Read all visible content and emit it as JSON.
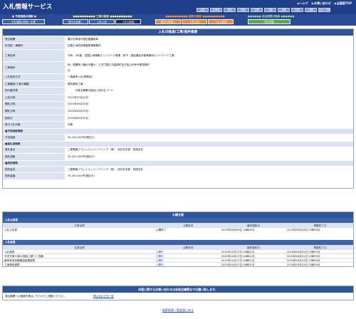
{
  "header": {
    "app_title": "入札情報サービス",
    "top_links": [
      "▶ヘルプ",
      "▶お問い合わせ",
      "▶全国版TOP"
    ],
    "regions": [
      "全国",
      "北海道",
      "東北",
      "関東",
      "北陸",
      "中部",
      "近畿",
      "中国",
      "四国",
      "九州・沖縄"
    ]
  },
  "nav": {
    "groups": [
      {
        "caption": "● 予定価格の検索 ●",
        "caption_color": "#ffffff",
        "tabs": [
          {
            "label": "予定価格の検索・結果",
            "bg": "#3f61a8"
          }
        ]
      },
      {
        "caption": "●●●●●●●●●● 工事の検索 ●●●●●●●●●●",
        "caption_color": "#f2f2a0",
        "tabs": [
          {
            "label": "発注の見通し",
            "bg": "#3f61a8"
          },
          {
            "label": "入札公告",
            "bg": "#3f61a8"
          },
          {
            "label": "入札の経過",
            "bg": "#1a2d63"
          }
        ]
      },
      {
        "caption": "●●●●●●●●●● 業務の検索 ●●●●●●●●●●",
        "caption_color": "#f3a04c",
        "tabs": [
          {
            "label": "発注の見通し",
            "bg": "#e98a33"
          },
          {
            "label": "入札公告",
            "bg": "#e98a33"
          },
          {
            "label": "入札の経過",
            "bg": "#e98a33"
          }
        ]
      },
      {
        "caption": "●●●●●● 自治機関の検索 ●●●●●●",
        "caption_color": "#9fe08e",
        "tabs": [
          {
            "label": "発注情報",
            "bg": "#5aa848"
          }
        ]
      }
    ]
  },
  "main": {
    "title": "入札の経過(工事)案件概要",
    "rows": [
      {
        "label": "発注機関",
        "value": "豊井文庫省中国四国農政局"
      },
      {
        "label": "担当部・事務所",
        "value": "四国土地改良調査管理事務所"
      },
      {
        "label": "工事名称",
        "value": "令和　4年度　四国土地情報ネットワーク事業　新予・虚絵通信手動等基地ネットワーク工事"
      },
      {
        "label": "工事場所",
        "value": "他：愛媛県八幡浜市豊川、上浮穴郡久万高原町及び松山市伊予郡松前町",
        "value2": "ほ",
        "tall": true
      },
      {
        "label": "入札契約方式",
        "value": "一般競争入札(標準型)"
      },
      {
        "label": "工事種別/工事の種類",
        "value": "電気通信工事"
      },
      {
        "label": "旅行番号等",
        "value": "　　　※発注機関が独自に定めるコード"
      },
      {
        "label": "公告日時",
        "value": "2022年07月22日"
      },
      {
        "label": "開札日時",
        "value": "2022年09月29日"
      },
      {
        "label": "開札日時",
        "value": "2022年09月29日"
      },
      {
        "label": "契約日",
        "value": "2022年09月30日"
      },
      {
        "label": "電子入札対象",
        "value": "対象"
      }
    ],
    "section_price": "■予定価格情報",
    "price_rows": [
      {
        "label": "予定価格",
        "value": "39,410,000円(税抜き)"
      }
    ],
    "section_bidder": "■落札者情報",
    "bidder_rows": [
      {
        "label": "落札者名",
        "value": "三菱電機プラントエンジニアリング（株）　西日本本部　四国支社"
      },
      {
        "label": "落札価格",
        "value": "39,200,000円(税抜き)"
      }
    ],
    "section_contract": "■契約情報",
    "contract_rows": [
      {
        "label": "契約者名",
        "value": "三菱電機プラントエンジニアリング（株）　西日本本部　四国支社"
      },
      {
        "label": "契約金額",
        "value": "39,200,000円(税抜き)"
      }
    ]
  },
  "docs": {
    "title": "公開文書",
    "sections": [
      {
        "name": "入札公告等",
        "headers": [
          "文書名称",
          "公開状況",
          "最終更新日",
          "掲載終了日"
        ],
        "rows": [
          {
            "name": "入札公告書",
            "status": "公開終了",
            "updated": "2022年09月06日 16時00分",
            "end": "2022年09月28日 23時59分"
          }
        ]
      },
      {
        "name": "入札経過",
        "headers": [
          "文書名称",
          "公開状況",
          "最終更新日",
          "掲載終了日"
        ],
        "rows": [
          {
            "name": "入札調書",
            "status": "公開中",
            "updated": "2022年10月17日 04時01分",
            "end": "2024年03月31日 23時59分"
          },
          {
            "name": "予決令第73条の規定に基づく資格",
            "status": "公開中",
            "updated": "2022年10月17日 04時01分",
            "end": "2024年03月31日 23時59分"
          },
          {
            "name": "競争参加資格確認結果調書",
            "status": "公開中",
            "updated": "2022年10月17日 04時01分",
            "end": "2024年03月31日 23時59分"
          },
          {
            "name": "工事契約調書",
            "status": "公開中",
            "updated": "2022年10月17日 04時01分",
            "end": "2024年03月31日 23時59分"
          }
        ]
      }
    ]
  },
  "contact": {
    "title": "内容に関するお問い合わせは各発注機関までお願い致します。",
    "label": "発注機関への連絡先等はこちらからご確認ください。",
    "link": "問い合わせ先一覧"
  },
  "back_link": "検索結果一覧画面に戻る",
  "colors": {
    "header": "#1f3f8a",
    "section": "#2f5598",
    "label_bg": "#dbe3f0",
    "link": "#1a44b8"
  }
}
